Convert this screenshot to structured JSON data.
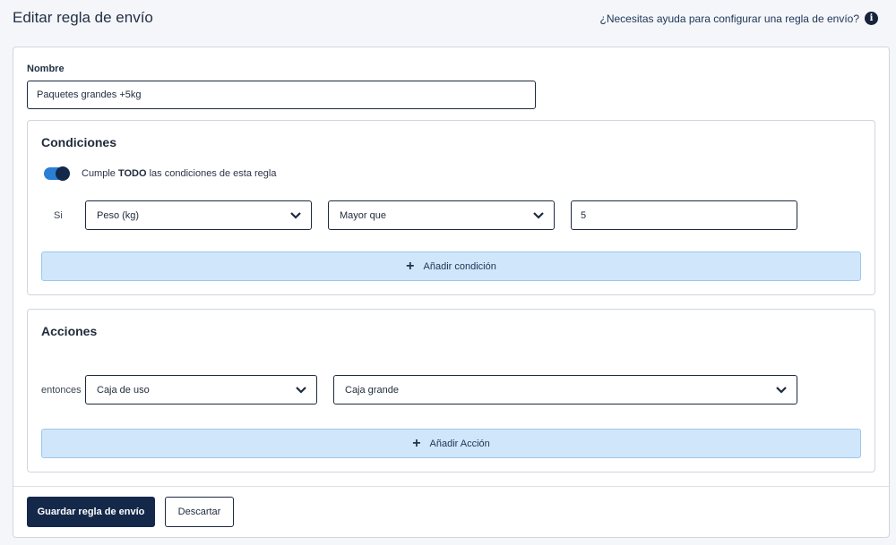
{
  "page": {
    "title": "Editar regla de envío",
    "help_text": "¿Necesitas ayuda para configurar una regla de envío?",
    "help_icon_glyph": "i"
  },
  "name_field": {
    "label": "Nombre",
    "value": "Paquetes grandes +5kg"
  },
  "conditions": {
    "title": "Condiciones",
    "toggle_on": true,
    "toggle_label_prefix": "Cumple",
    "toggle_label_bold": "TODO",
    "toggle_label_suffix": "las condiciones de esta regla",
    "row_label": "Si",
    "field_select": "Peso (kg)",
    "operator_select": "Mayor que",
    "value": "5",
    "add_label": "Añadir condición"
  },
  "actions": {
    "title": "Acciones",
    "row_label": "entonces",
    "action_select": "Caja de uso",
    "target_select": "Caja grande",
    "add_label": "Añadir Acción"
  },
  "footer": {
    "save_label": "Guardar regla de envío",
    "discard_label": "Descartar"
  },
  "colors": {
    "primary": "#14284a",
    "accent_toggle": "#2a7fd4",
    "add_button_bg": "#d0e6fa"
  },
  "icons": {
    "info": "info-icon",
    "chevron": "chevron-down-icon",
    "plus": "plus-icon"
  }
}
